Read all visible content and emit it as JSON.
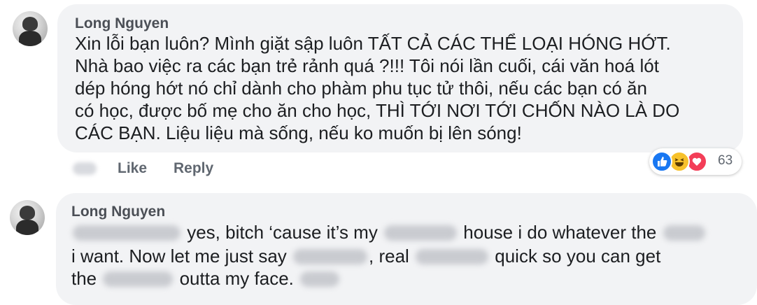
{
  "comment1": {
    "author": "Long Nguyen",
    "text": "Xin lỗi bạn luôn? Mình giặt sập luôn TẤT CẢ CÁC THỂ LOẠI HÓNG HỚT.\nNhà bao việc ra các bạn trẻ rảnh quá ?!!! Tôi nói lần cuối, cái văn hoá lót\ndép hóng hớt nó chỉ dành cho phàm phu tục tử thôi, nếu các bạn có ăn\ncó học, được bố mẹ cho ăn cho học, THÌ TỚI NƠI TỚI CHỐN NÀO LÀ DO\nCÁC BẠN. Liệu liệu mà sống, nếu ko muốn bị lên sóng!",
    "like_label": "Like",
    "reply_label": "Reply",
    "reaction_count": "63",
    "reaction_icons": [
      "like-icon",
      "haha-icon",
      "love-icon"
    ]
  },
  "comment2": {
    "author": "Long Nguyen",
    "line1": [
      " yes, bitch ‘cause it’s my ",
      " house i do whatever the "
    ],
    "line2": [
      "i want. Now let me just say ",
      ", real ",
      " quick so you can get"
    ],
    "line3": [
      "the ",
      " outta my face. "
    ]
  },
  "colors": {
    "bubble": "#f2f3f5",
    "like": "#1877f2",
    "haha": "#f7c12b",
    "love": "#f33e58",
    "action_text": "#606770"
  }
}
